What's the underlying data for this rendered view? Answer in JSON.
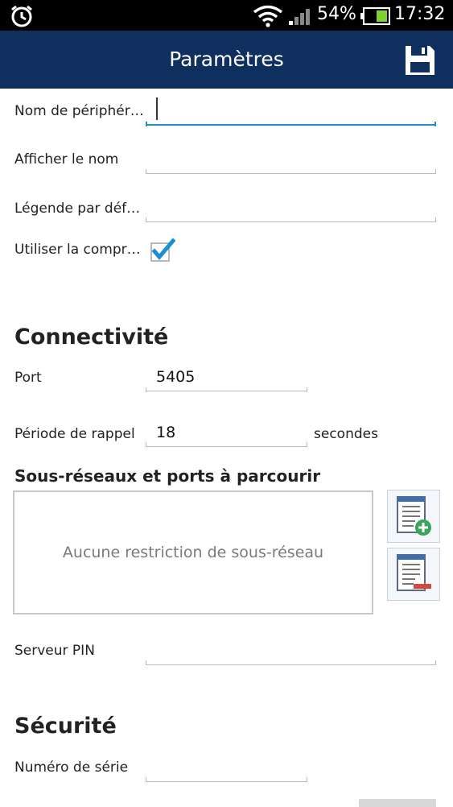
{
  "status_bar": {
    "battery_percent": "54%",
    "time": "17:32"
  },
  "app_bar": {
    "title": "Paramètres",
    "save_icon": "floppy-disk-icon"
  },
  "general": {
    "device_name_label": "Nom de périphér…",
    "device_name_value": "",
    "display_name_label": "Afficher le nom",
    "display_name_value": "",
    "default_caption_label": "Légende par déf…",
    "default_caption_value": "",
    "use_compression_label": "Utiliser la compr…",
    "use_compression_checked": true
  },
  "connectivity": {
    "title": "Connectivité",
    "port_label": "Port",
    "port_value": "5405",
    "recall_label": "Période de rappel",
    "recall_value": "18",
    "recall_unit": "secondes",
    "subnets_title": "Sous-réseaux et ports à parcourir",
    "subnets_empty": "Aucune restriction de sous-réseau",
    "add_subnet_icon": "add-list-icon",
    "remove_subnet_icon": "remove-list-icon",
    "pin_server_label": "Serveur PIN",
    "pin_server_value": ""
  },
  "security": {
    "title": "Sécurité",
    "serial_label": "Numéro de série",
    "serial_value": ""
  },
  "colors": {
    "app_bar": "#0f2f5e",
    "accent": "#1d8fd0",
    "checkbox": "#1d8fd0"
  }
}
